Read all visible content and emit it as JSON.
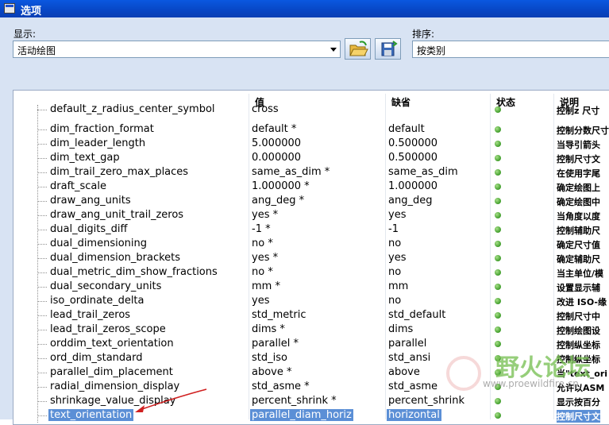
{
  "window": {
    "title": "选项"
  },
  "display": {
    "label": "显示:",
    "value": "活动绘图"
  },
  "sort": {
    "label": "排序:",
    "value": "按类别"
  },
  "table": {
    "headers": {
      "value": "值",
      "default": "缺省",
      "status": "状态",
      "desc": "说明"
    },
    "rows": [
      {
        "name": "default_z_radius_center_symbol",
        "value": "cross",
        "default": "",
        "desc": "控制z 尺寸"
      },
      {
        "name": "dim_fraction_format",
        "value": "default *",
        "default": "default",
        "desc": "控制分数尺寸"
      },
      {
        "name": "dim_leader_length",
        "value": "5.000000",
        "default": "0.500000",
        "desc": "当导引箭头"
      },
      {
        "name": "dim_text_gap",
        "value": "0.000000",
        "default": "0.500000",
        "desc": "控制尺寸文"
      },
      {
        "name": "dim_trail_zero_max_places",
        "value": "same_as_dim *",
        "default": "same_as_dim",
        "desc": "在使用字尾"
      },
      {
        "name": "draft_scale",
        "value": "1.000000 *",
        "default": "1.000000",
        "desc": "确定绘图上"
      },
      {
        "name": "draw_ang_units",
        "value": "ang_deg *",
        "default": "ang_deg",
        "desc": "确定绘图中"
      },
      {
        "name": "draw_ang_unit_trail_zeros",
        "value": "yes *",
        "default": "yes",
        "desc": "当角度以度"
      },
      {
        "name": "dual_digits_diff",
        "value": "-1 *",
        "default": "-1",
        "desc": "控制辅助尺"
      },
      {
        "name": "dual_dimensioning",
        "value": "no *",
        "default": "no",
        "desc": "确定尺寸值"
      },
      {
        "name": "dual_dimension_brackets",
        "value": "yes *",
        "default": "yes",
        "desc": "确定辅助尺"
      },
      {
        "name": "dual_metric_dim_show_fractions",
        "value": "no *",
        "default": "no",
        "desc": "当主单位/模"
      },
      {
        "name": "dual_secondary_units",
        "value": "mm *",
        "default": "mm",
        "desc": "设置显示辅"
      },
      {
        "name": "iso_ordinate_delta",
        "value": "yes",
        "default": "no",
        "desc": "改进 ISO-缘"
      },
      {
        "name": "lead_trail_zeros",
        "value": "std_metric",
        "default": "std_default",
        "desc": "控制尺寸中"
      },
      {
        "name": "lead_trail_zeros_scope",
        "value": "dims *",
        "default": "dims",
        "desc": "控制绘图设"
      },
      {
        "name": "orddim_text_orientation",
        "value": "parallel *",
        "default": "parallel",
        "desc": "控制纵坐标"
      },
      {
        "name": "ord_dim_standard",
        "value": "std_iso",
        "default": "std_ansi",
        "desc": "控制纵坐标"
      },
      {
        "name": "parallel_dim_placement",
        "value": "above *",
        "default": "above",
        "desc": "当\"text_ori"
      },
      {
        "name": "radial_dimension_display",
        "value": "std_asme *",
        "default": "std_asme",
        "desc": "允许以ASM"
      },
      {
        "name": "shrinkage_value_display",
        "value": "percent_shrink *",
        "default": "percent_shrink",
        "desc": "显示按百分"
      },
      {
        "name": "text_orientation",
        "value": "parallel_diam_horiz",
        "default": "horizontal",
        "desc": "控制尺寸文"
      }
    ]
  },
  "watermark": {
    "text": "野火论坛",
    "url": "www.proewildfire.cn"
  },
  "colors": {
    "titlebar": "#0a4ed4",
    "panel": "#d8e3f3",
    "status_ok": "#3f9d2a",
    "selection": "#5b8fd6"
  }
}
